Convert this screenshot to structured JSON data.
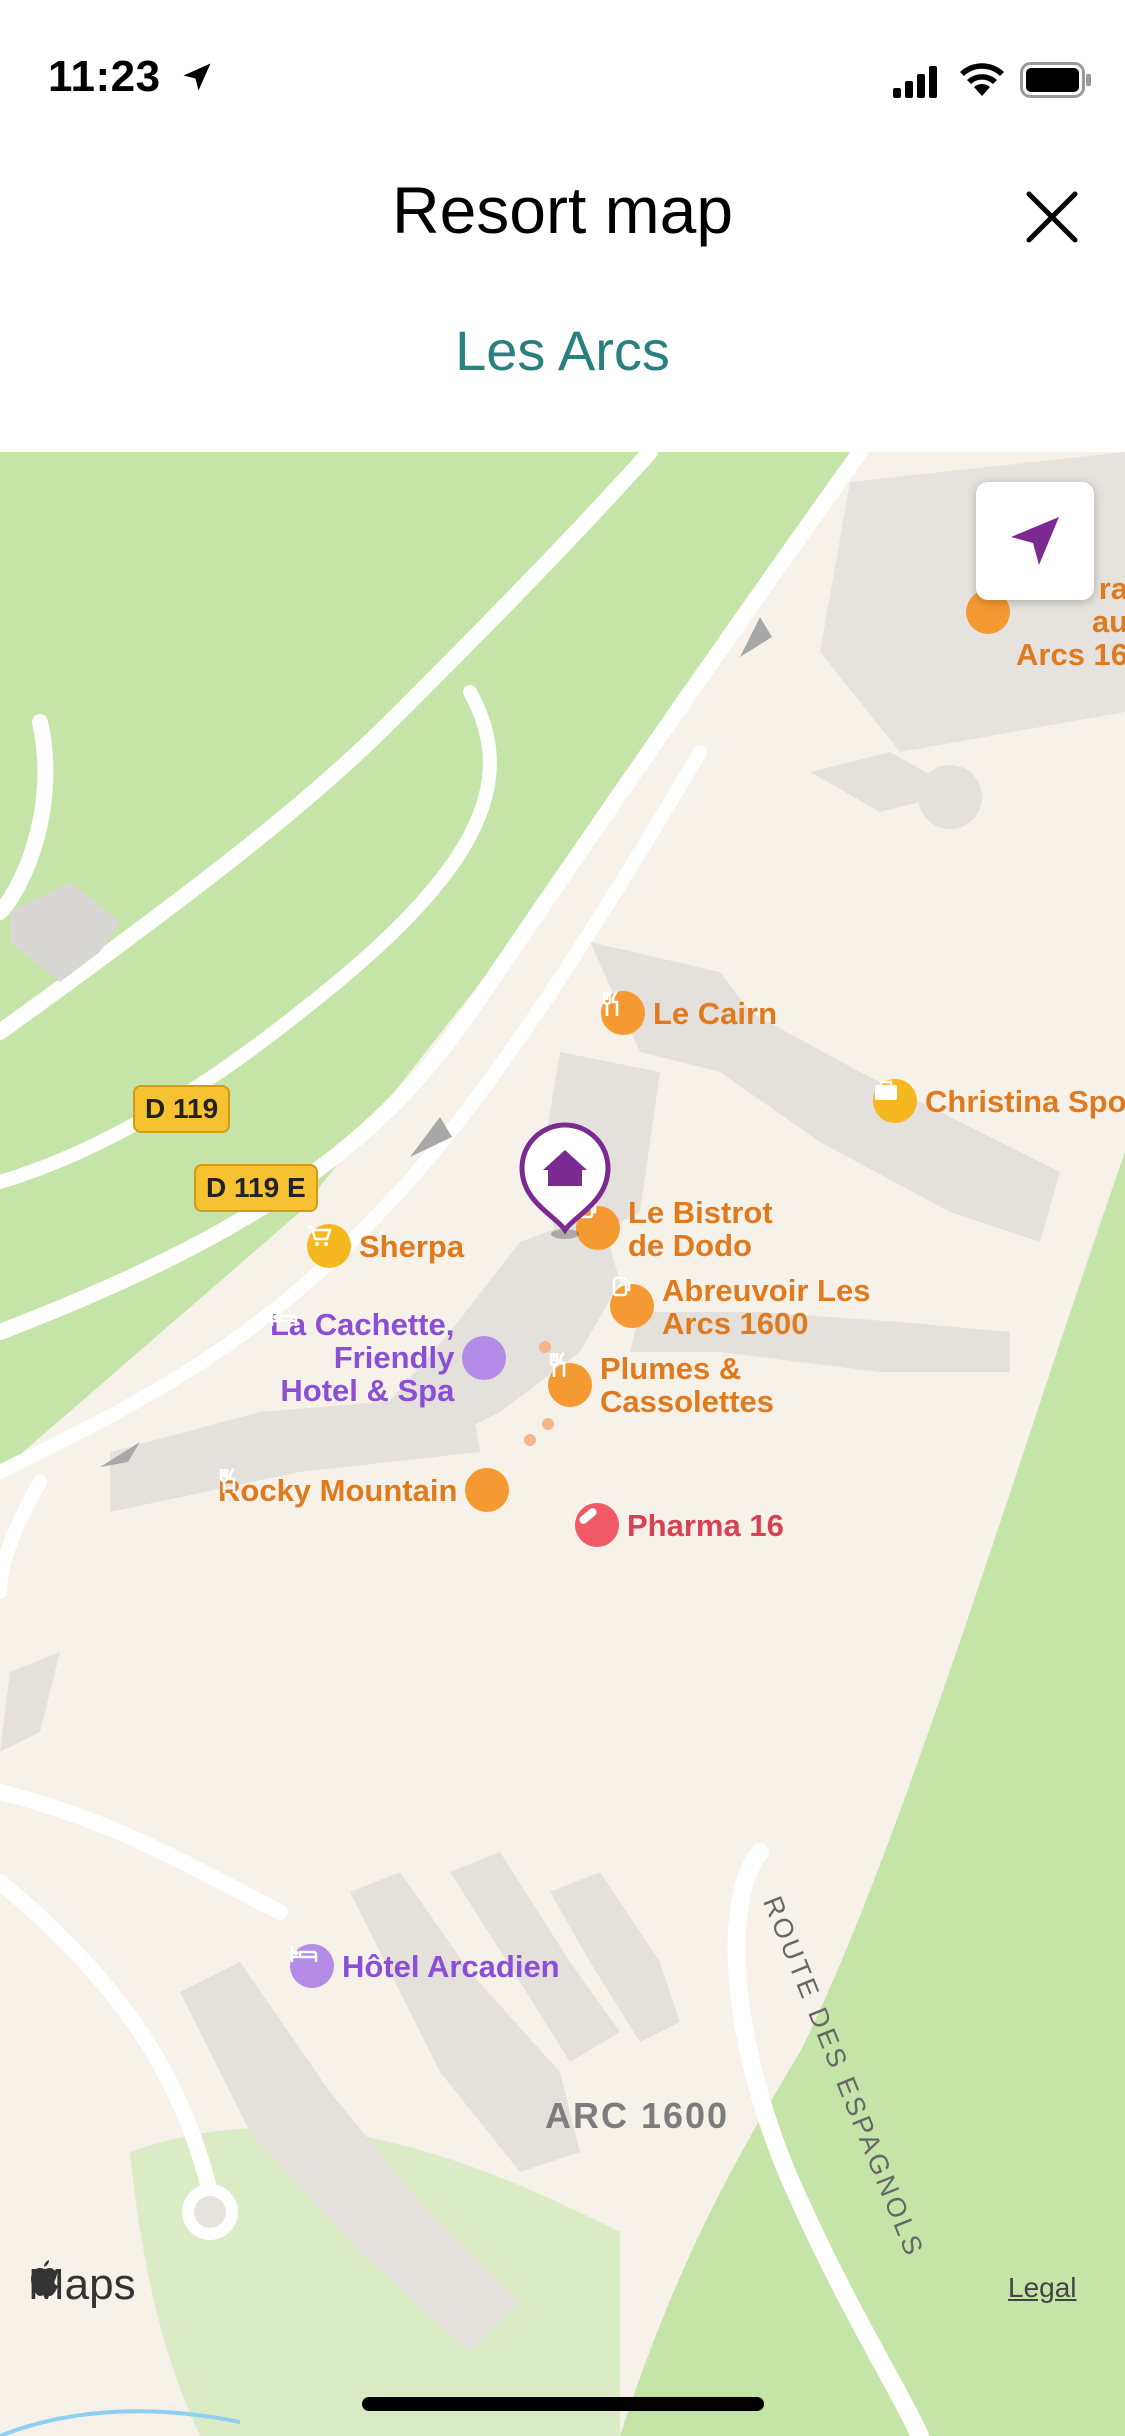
{
  "status_bar": {
    "time": "11:23"
  },
  "header": {
    "title": "Resort map",
    "subtitle": "Les Arcs"
  },
  "map": {
    "road_shields": [
      "D 119",
      "D 119 E"
    ],
    "area_label": "ARC 1600",
    "road_label": "ROUTE DES ESPAGNOLS",
    "pois": {
      "le_cairn": "Le Cairn",
      "christina_sport": "Christina Spo",
      "bistrot_1": "Le Bistrot",
      "bistrot_2": "de Dodo",
      "abreuvoir_1": "Abreuvoir Les",
      "abreuvoir_2": "Arcs 1600",
      "sherpa": "Sherpa",
      "cachette_1": "La Cachette,",
      "cachette_2": "Friendly",
      "cachette_3": "Hotel & Spa",
      "plumes_1": "Plumes &",
      "plumes_2": "Cassolettes",
      "rocky": "Rocky Mountain",
      "pharma": "Pharma 16",
      "arcadien": "Hôtel Arcadien",
      "top_right_1": "ra",
      "top_right_2": "au",
      "top_right_3": "Arcs 16"
    },
    "attribution": "Maps",
    "legal": "Legal"
  },
  "colors": {
    "accent": "#2a8080",
    "pin": "#7b2a91",
    "park": "#c5e4a8",
    "land": "#f6f2ea"
  }
}
